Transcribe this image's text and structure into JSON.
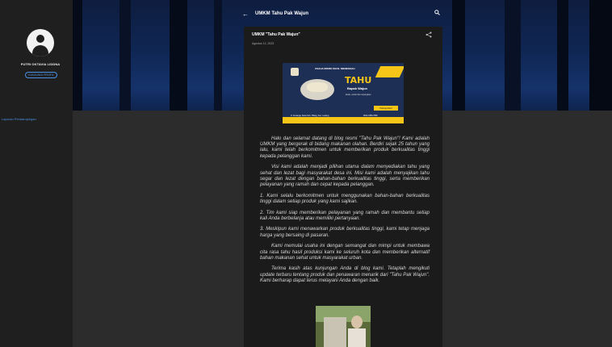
{
  "sidebar": {
    "profile_name": "PUTRI OKTAVIA LIDDNA",
    "profile_button": "KUNJUNGI PROFIL",
    "link": "Laporan Pendampingan"
  },
  "header": {
    "title": "UMKM Tahu Pak Wajun",
    "back_icon": "arrow-left-icon",
    "search_icon": "search-icon"
  },
  "post": {
    "title": "UMKM \"Tahu Pak Wajun\"",
    "date": "Agustus 12, 2023",
    "share_icon": "share-icon",
    "image": {
      "heading": "USAHA MIKRO KECIL MENENGAH",
      "brand": "TAHU",
      "subtitle": "Bapak Wajun",
      "tagline": "Enak, sehat dan terjangkau",
      "button": "Hubungi Kami",
      "footer_left": "Jl. Kenanga, Desa Keb. Hilang, Kec. Ledeng",
      "footer_right": "0812-3456-7890"
    },
    "paragraphs": [
      "Halo dan selamat datang di blog resmi \"Tahu Pak Wajun\"! Kami adalah UMKM yang bergerak di bidang makanan olahan. Berdiri sejak 25 tahun yang lalu, kami telah berkomitmen untuk memberikan produk berkualitas tinggi kepada pelanggan kami.",
      "Visi kami adalah menjadi pilihan utama dalam menyediakan tahu yang sehat dan lezat bagi masyarakat desa ini. Misi kami adalah menyajikan tahu segar dan lezat dengan bahan-bahan berkualitas tinggi, serta memberikan pelayanan yang ramah dan cepat kepada pelanggan.",
      "1. Kami selalu berkomitmen untuk menggunakan bahan-bahan berkualitas tinggi dalam setiap produk yang kami sajikan.",
      "2. Tim kami siap memberikan pelayanan yang ramah dan membantu setiap kali Anda berbelanja atau memiliki pertanyaan.",
      "3. Meskipun kami menawarkan produk berkualitas tinggi, kami tetap menjaga harga yang bersaing di pasaran.",
      "Kami memulai usaha ini dengan semangat dan mimpi untuk membawa cita rasa tahu hasil produksi kami ke seluruh kota dan memberikan alternatif bahan makanan sehat untuk masyarakat urban.",
      "Terima kasih atas kunjungan Anda di blog kami. Tetaplah mengikuti update terbaru tentang produk dan penawaran menarik dari \"Tahu Pak Wajun\". Kami berharap dapat terus melayani Anda dengan baik."
    ]
  },
  "colors": {
    "accent": "#4a90e2",
    "card": "#1b1b1b",
    "background": "#2c2c2c",
    "sidebar": "#1f1f1f"
  }
}
